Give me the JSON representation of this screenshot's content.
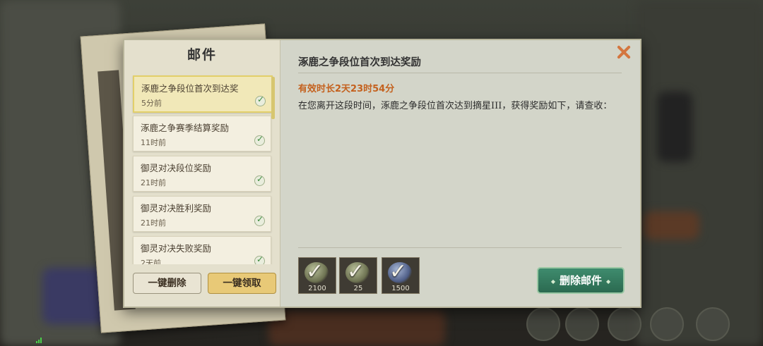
{
  "panel": {
    "left_title": "邮件",
    "mails": [
      {
        "subject": "涿鹿之争段位首次到达奖",
        "time": "5分前",
        "selected": true
      },
      {
        "subject": "涿鹿之争赛季结算奖励",
        "time": "11时前",
        "selected": false
      },
      {
        "subject": "御灵对决段位奖励",
        "time": "21时前",
        "selected": false
      },
      {
        "subject": "御灵对决胜利奖励",
        "time": "21时前",
        "selected": false
      },
      {
        "subject": "御灵对决失败奖励",
        "time": "2天前",
        "selected": false
      }
    ],
    "buttons": {
      "delete_all": "一键删除",
      "collect_all": "一键领取",
      "delete_mail": "删除邮件"
    }
  },
  "detail": {
    "title": "涿鹿之争段位首次到达奖励",
    "expiry": "有效时长2天23时54分",
    "body": "在您离开这段时间，涿鹿之争段位首次达到摘星III，获得奖励如下，请查收："
  },
  "rewards": [
    {
      "qty": "2100",
      "icon": "green-gem-icon",
      "claimed": true
    },
    {
      "qty": "25",
      "icon": "green-shard-icon",
      "claimed": true
    },
    {
      "qty": "1500",
      "icon": "blue-gem-icon",
      "claimed": true
    }
  ],
  "colors": {
    "expiry": "#c4611e",
    "accent_green": "#2b6a50",
    "accent_gold": "#e8c977"
  }
}
